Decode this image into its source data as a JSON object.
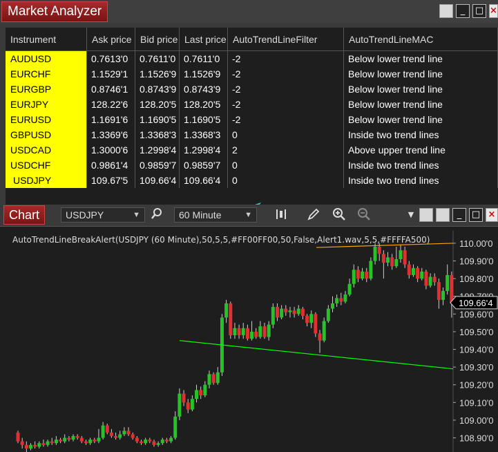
{
  "market_analyzer": {
    "title": "Market Analyzer",
    "columns": [
      "Instrument",
      "Ask price",
      "Bid price",
      "Last price",
      "AutoTrendLineFilter",
      "AutoTrendLineMAC"
    ],
    "rows": [
      {
        "instrument": "AUDUSD",
        "ask": "0.7613'0",
        "bid": "0.7611'0",
        "last": "0.7611'0",
        "filter": "-2",
        "mac": "Below lower trend line"
      },
      {
        "instrument": "EURCHF",
        "ask": "1.1529'1",
        "bid": "1.1526'9",
        "last": "1.1526'9",
        "filter": "-2",
        "mac": "Below lower trend line"
      },
      {
        "instrument": "EURGBP",
        "ask": "0.8746'1",
        "bid": "0.8743'9",
        "last": "0.8743'9",
        "filter": "-2",
        "mac": "Below lower trend line"
      },
      {
        "instrument": "EURJPY",
        "ask": "128.22'6",
        "bid": "128.20'5",
        "last": "128.20'5",
        "filter": "-2",
        "mac": "Below lower trend line"
      },
      {
        "instrument": "EURUSD",
        "ask": "1.1691'6",
        "bid": "1.1690'5",
        "last": "1.1690'5",
        "filter": "-2",
        "mac": "Below lower trend line"
      },
      {
        "instrument": "GBPUSD",
        "ask": "1.3369'6",
        "bid": "1.3368'3",
        "last": "1.3368'3",
        "filter": "0",
        "mac": "Inside two trend lines"
      },
      {
        "instrument": "USDCAD",
        "ask": "1.3000'6",
        "bid": "1.2998'4",
        "last": "1.2998'4",
        "filter": "2",
        "mac": "Above upper trend line"
      },
      {
        "instrument": "USDCHF",
        "ask": "0.9861'4",
        "bid": "0.9859'7",
        "last": "0.9859'7",
        "filter": "0",
        "mac": "Inside two trend lines"
      },
      {
        "instrument": "USDJPY",
        "ask": "109.67'5",
        "bid": "109.66'4",
        "last": "109.66'4",
        "filter": "0",
        "mac": "Inside two trend lines"
      }
    ],
    "colors": {
      "instrument_bg": "#ffff00",
      "arrow": "#2ad4d4"
    }
  },
  "chart": {
    "tab_label": "Chart",
    "instrument": "USDJPY",
    "interval": "60 Minute",
    "indicator_label": "AutoTrendLineBreakAlert(USDJPY (60 Minute),50,5,5,#FF00FF00,50,False,Alert1.wav,5,5,#FFFFA500)",
    "current_price": "109.66'4",
    "icons": [
      "search-icon",
      "bar-style-icon",
      "pencil-icon",
      "zoom-in-icon",
      "zoom-out-icon",
      "dropdown-icon"
    ],
    "colors": {
      "up": "#27c227",
      "down": "#e03030",
      "upper_trend": "#ffa500",
      "lower_trend": "#00ff00"
    }
  },
  "chart_data": {
    "type": "candlestick",
    "y_axis_ticks": [
      "110.00'0",
      "109.90'0",
      "109.80'0",
      "109.70'0",
      "109.60'0",
      "109.50'0",
      "109.40'0",
      "109.30'0",
      "109.20'0",
      "109.10'0",
      "109.00'0",
      "108.90'0"
    ],
    "ylim": [
      108.82,
      110.07
    ],
    "upper_trend_line": {
      "start": 109.976,
      "end": 110.0
    },
    "lower_trend_line": {
      "start": 109.45,
      "end": 109.29
    },
    "candles": [
      [
        108.93,
        108.88,
        108.94,
        108.87
      ],
      [
        108.88,
        108.86,
        108.9,
        108.84
      ],
      [
        108.86,
        108.84,
        108.88,
        108.82
      ],
      [
        108.84,
        108.86,
        108.87,
        108.83
      ],
      [
        108.86,
        108.85,
        108.88,
        108.84
      ],
      [
        108.85,
        108.87,
        108.88,
        108.84
      ],
      [
        108.87,
        108.86,
        108.89,
        108.85
      ],
      [
        108.86,
        108.88,
        108.89,
        108.85
      ],
      [
        108.88,
        108.87,
        108.9,
        108.86
      ],
      [
        108.87,
        108.89,
        108.91,
        108.86
      ],
      [
        108.89,
        108.88,
        108.9,
        108.87
      ],
      [
        108.88,
        108.9,
        108.92,
        108.87
      ],
      [
        108.9,
        108.89,
        108.91,
        108.88
      ],
      [
        108.89,
        108.91,
        108.92,
        108.88
      ],
      [
        108.91,
        108.9,
        108.92,
        108.89
      ],
      [
        108.9,
        108.88,
        108.91,
        108.87
      ],
      [
        108.88,
        108.87,
        108.89,
        108.86
      ],
      [
        108.87,
        108.89,
        108.9,
        108.86
      ],
      [
        108.89,
        108.88,
        108.9,
        108.87
      ],
      [
        108.88,
        108.9,
        108.95,
        108.87
      ],
      [
        108.9,
        108.97,
        108.99,
        108.89
      ],
      [
        108.97,
        108.93,
        108.98,
        108.92
      ],
      [
        108.93,
        108.91,
        108.95,
        108.9
      ],
      [
        108.91,
        108.9,
        108.93,
        108.89
      ],
      [
        108.9,
        108.92,
        108.94,
        108.89
      ],
      [
        108.92,
        108.94,
        108.96,
        108.91
      ],
      [
        108.94,
        108.92,
        108.96,
        108.91
      ],
      [
        108.92,
        108.9,
        108.93,
        108.89
      ],
      [
        108.9,
        108.88,
        108.91,
        108.87
      ],
      [
        108.88,
        108.87,
        108.89,
        108.86
      ],
      [
        108.87,
        108.89,
        108.9,
        108.86
      ],
      [
        108.89,
        108.88,
        108.9,
        108.87
      ],
      [
        108.88,
        108.86,
        108.89,
        108.85
      ],
      [
        108.86,
        108.87,
        108.88,
        108.85
      ],
      [
        108.87,
        108.89,
        108.9,
        108.86
      ],
      [
        108.89,
        108.88,
        108.9,
        108.87
      ],
      [
        108.88,
        108.9,
        108.91,
        108.87
      ],
      [
        108.9,
        109.02,
        109.05,
        108.89
      ],
      [
        109.02,
        109.15,
        109.18,
        109.0
      ],
      [
        109.15,
        109.1,
        109.17,
        109.08
      ],
      [
        109.1,
        109.06,
        109.12,
        109.04
      ],
      [
        109.06,
        109.12,
        109.14,
        109.05
      ],
      [
        109.12,
        109.17,
        109.2,
        109.1
      ],
      [
        109.17,
        109.14,
        109.19,
        109.12
      ],
      [
        109.14,
        109.2,
        109.22,
        109.13
      ],
      [
        109.2,
        109.26,
        109.28,
        109.18
      ],
      [
        109.26,
        109.21,
        109.27,
        109.2
      ],
      [
        109.21,
        109.27,
        109.3,
        109.2
      ],
      [
        109.27,
        109.58,
        109.6,
        109.25
      ],
      [
        109.58,
        109.66,
        109.68,
        109.55
      ],
      [
        109.66,
        109.48,
        109.67,
        109.46
      ],
      [
        109.48,
        109.52,
        109.55,
        109.46
      ],
      [
        109.52,
        109.48,
        109.54,
        109.46
      ],
      [
        109.48,
        109.52,
        109.55,
        109.46
      ],
      [
        109.52,
        109.46,
        109.54,
        109.45
      ],
      [
        109.46,
        109.5,
        109.56,
        109.45
      ],
      [
        109.5,
        109.47,
        109.52,
        109.46
      ],
      [
        109.47,
        109.53,
        109.56,
        109.46
      ],
      [
        109.53,
        109.47,
        109.55,
        109.46
      ],
      [
        109.47,
        109.54,
        109.56,
        109.45
      ],
      [
        109.54,
        109.64,
        109.66,
        109.52
      ],
      [
        109.64,
        109.58,
        109.66,
        109.56
      ],
      [
        109.58,
        109.63,
        109.65,
        109.57
      ],
      [
        109.63,
        109.61,
        109.65,
        109.59
      ],
      [
        109.61,
        109.62,
        109.64,
        109.58
      ],
      [
        109.62,
        109.6,
        109.64,
        109.58
      ],
      [
        109.6,
        109.63,
        109.65,
        109.59
      ],
      [
        109.63,
        109.59,
        109.64,
        109.57
      ],
      [
        109.59,
        109.55,
        109.6,
        109.53
      ],
      [
        109.55,
        109.6,
        109.62,
        109.52
      ],
      [
        109.6,
        109.49,
        109.61,
        109.47
      ],
      [
        109.49,
        109.45,
        109.51,
        109.38
      ],
      [
        109.45,
        109.56,
        109.58,
        109.44
      ],
      [
        109.56,
        109.63,
        109.65,
        109.55
      ],
      [
        109.63,
        109.66,
        109.7,
        109.61
      ],
      [
        109.66,
        109.69,
        109.71,
        109.64
      ],
      [
        109.69,
        109.67,
        109.72,
        109.65
      ],
      [
        109.67,
        109.71,
        109.73,
        109.66
      ],
      [
        109.71,
        109.77,
        109.8,
        109.7
      ],
      [
        109.77,
        109.85,
        109.88,
        109.75
      ],
      [
        109.85,
        109.8,
        109.87,
        109.78
      ],
      [
        109.8,
        109.84,
        109.86,
        109.79
      ],
      [
        109.84,
        109.8,
        109.86,
        109.78
      ],
      [
        109.8,
        109.9,
        109.92,
        109.79
      ],
      [
        109.9,
        109.98,
        110.0,
        109.88
      ],
      [
        109.98,
        109.94,
        110.0,
        109.9
      ],
      [
        109.94,
        109.89,
        109.96,
        109.8
      ],
      [
        109.89,
        109.92,
        109.95,
        109.87
      ],
      [
        109.92,
        109.87,
        109.94,
        109.85
      ],
      [
        109.87,
        109.91,
        109.98,
        109.86
      ],
      [
        109.91,
        109.96,
        109.99,
        109.89
      ],
      [
        109.96,
        109.88,
        109.98,
        109.86
      ],
      [
        109.88,
        109.82,
        109.9,
        109.8
      ],
      [
        109.82,
        109.86,
        109.88,
        109.81
      ],
      [
        109.86,
        109.8,
        109.87,
        109.78
      ],
      [
        109.8,
        109.84,
        109.86,
        109.79
      ],
      [
        109.84,
        109.76,
        109.85,
        109.74
      ],
      [
        109.76,
        109.81,
        109.83,
        109.75
      ],
      [
        109.81,
        109.78,
        109.83,
        109.76
      ],
      [
        109.78,
        109.68,
        109.8,
        109.63
      ],
      [
        109.68,
        109.73,
        109.75,
        109.65
      ],
      [
        109.73,
        109.82,
        109.88,
        109.71
      ],
      [
        109.82,
        109.66,
        109.84,
        109.58
      ]
    ]
  }
}
